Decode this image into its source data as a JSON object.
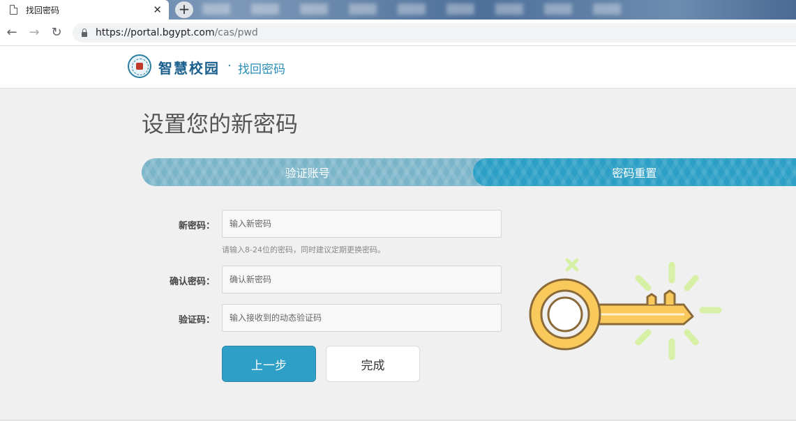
{
  "browser": {
    "tab_title": "找回密码",
    "tab_close": "✕",
    "new_tab": "+",
    "nav_back": "←",
    "nav_forward": "→",
    "nav_reload": "↻",
    "url_host": "https://portal.bgypt.com",
    "url_path": "/cas/pwd"
  },
  "header": {
    "brand": "智慧校园",
    "separator": "·",
    "subtitle": "找回密码"
  },
  "main": {
    "title": "设置您的新密码",
    "steps": [
      {
        "label": "验证账号",
        "state": "done"
      },
      {
        "label": "密码重置",
        "state": "active"
      }
    ],
    "form": {
      "new_password": {
        "label": "新密码：",
        "placeholder": "输入新密码",
        "value": ""
      },
      "hint": "请输入8-24位的密码，同时建议定期更换密码。",
      "confirm_password": {
        "label": "确认密码：",
        "placeholder": "确认新密码",
        "value": ""
      },
      "captcha": {
        "label": "验证码：",
        "placeholder": "输入接收到的动态验证码",
        "value": ""
      }
    },
    "buttons": {
      "prev": "上一步",
      "done": "完成"
    }
  },
  "illustration": {
    "icon": "key-icon",
    "colors": {
      "key": "#f9c95c",
      "outline": "#8b6a3a",
      "sparkle": "#d6f0a6"
    }
  },
  "colors": {
    "accent": "#2e9fc6",
    "step_done": "#7ab4c8",
    "step_active": "#2b9fc5",
    "brand": "#1b5f8c"
  }
}
